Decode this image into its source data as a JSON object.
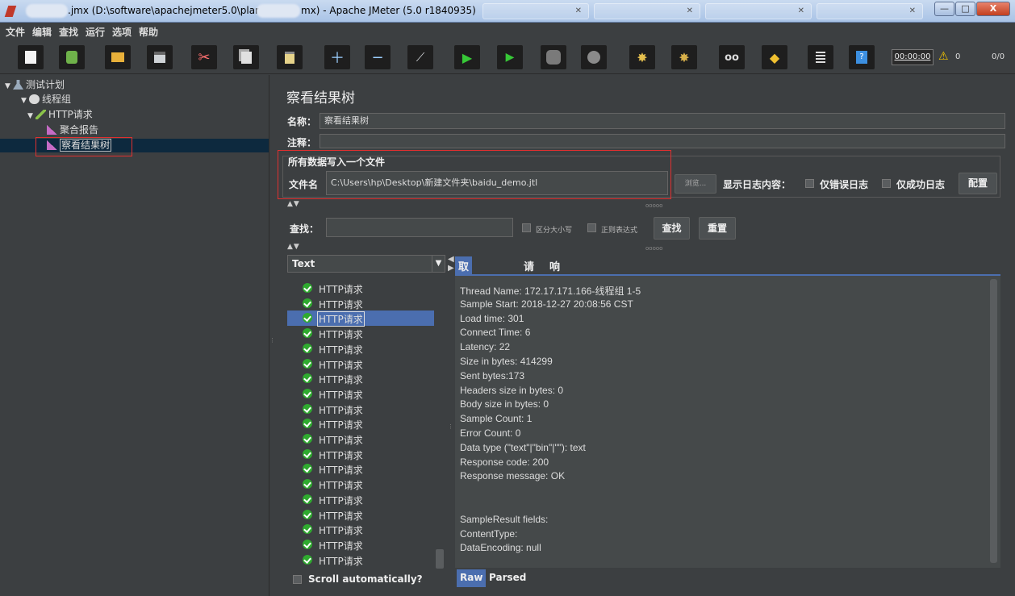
{
  "window": {
    "title_prefix": ".jmx (D:\\software\\apachejmeter5.0\\plans",
    "title_suffix": "mx) - Apache JMeter (5.0 r1840935)",
    "minimize": "—",
    "maximize": "□",
    "close": "X"
  },
  "menu": [
    "文件",
    "编辑",
    "查找",
    "运行",
    "选项",
    "帮助"
  ],
  "toolbar": {
    "timer": "00:00:00",
    "warning_icon": "⚠",
    "warning_count": "0",
    "thread_ratio": "0/0"
  },
  "tree": {
    "nodes": [
      {
        "label": "测试计划",
        "icon": "flask-icon"
      },
      {
        "label": "线程组",
        "icon": "gear-icon"
      },
      {
        "label": "HTTP请求",
        "icon": "pencil-icon"
      },
      {
        "label": "聚合报告",
        "icon": "chart-icon"
      },
      {
        "label": "察看结果树",
        "icon": "chart-icon"
      }
    ]
  },
  "panel": {
    "title": "察看结果树",
    "name_label": "名称：",
    "name_value": "察看结果树",
    "comment_label": "注释：",
    "comment_value": "",
    "file_group_label": "所有数据写入一个文件",
    "file_label": "文件名",
    "file_value": "C:\\Users\\hp\\Desktop\\新建文件夹\\baidu_demo.jtl",
    "browse_label": "浏览...",
    "log_label": "显示日志内容：",
    "errors_only_label": "仅错误日志",
    "success_only_label": "仅成功日志",
    "configure_label": "配置",
    "search_label": "查找：",
    "search_value": "",
    "case_label": "区分大小写",
    "regex_label": "正则表达式",
    "find_label": "查找",
    "reset_label": "重置"
  },
  "results": {
    "renderer": "Text",
    "items": [
      "HTTP请求",
      "HTTP请求",
      "HTTP请求",
      "HTTP请求",
      "HTTP请求",
      "HTTP请求",
      "HTTP请求",
      "HTTP请求",
      "HTTP请求",
      "HTTP请求",
      "HTTP请求",
      "HTTP请求",
      "HTTP请求",
      "HTTP请求",
      "HTTP请求",
      "HTTP请求",
      "HTTP请求",
      "HTTP请求",
      "HTTP请求",
      "HTTP请求"
    ],
    "selected_index": 2,
    "scroll_auto_label": "Scroll automatically?",
    "tabs": [
      "取样器结果",
      "请求",
      "响应数据"
    ],
    "active_tab": 0,
    "sampler_lines": [
      "Thread Name: 172.17.171.166-线程组 1-5",
      "Sample Start: 2018-12-27 20:08:56 CST",
      "Load time: 301",
      "Connect Time: 6",
      "Latency: 22",
      "Size in bytes: 414299",
      "Sent bytes:173",
      "Headers size in bytes: 0",
      "Body size in bytes: 0",
      "Sample Count: 1",
      "Error Count: 0",
      "Data type (\"text\"|\"bin\"|\"\"): text",
      "Response code: 200",
      "Response message: OK",
      "",
      "",
      "SampleResult fields:",
      "ContentType:",
      "DataEncoding: null"
    ],
    "bottom_tabs": [
      "Raw",
      "Parsed"
    ],
    "active_bottom_tab": 0
  }
}
